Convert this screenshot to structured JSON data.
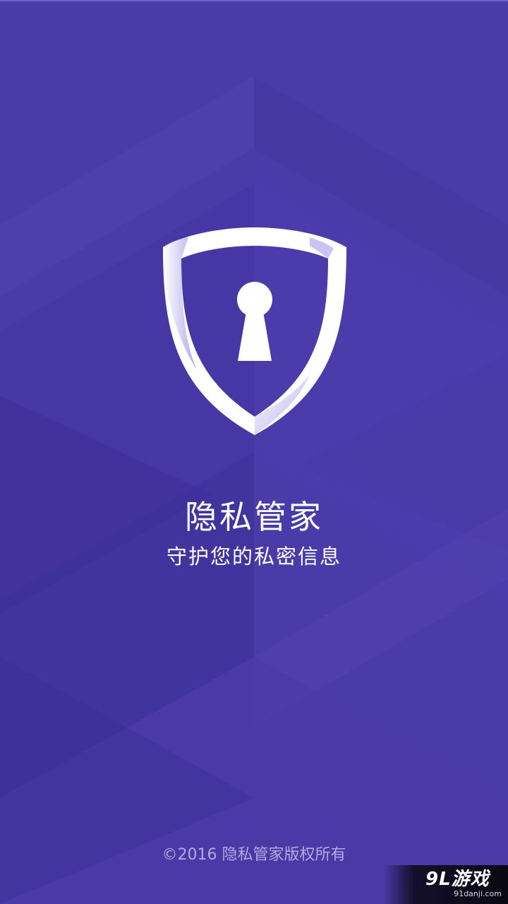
{
  "splash": {
    "app_name": "隐私管家",
    "tagline": "守护您的私密信息",
    "copyright": "©2016 隐私管家版权所有",
    "logo_icon": "shield-keyhole-icon"
  },
  "watermark": {
    "logo_text": "9L游戏",
    "url": "91danji.com"
  },
  "colors": {
    "background": "#4b3ba9",
    "text": "#ffffff",
    "copyright_text": "#b3aae0"
  }
}
